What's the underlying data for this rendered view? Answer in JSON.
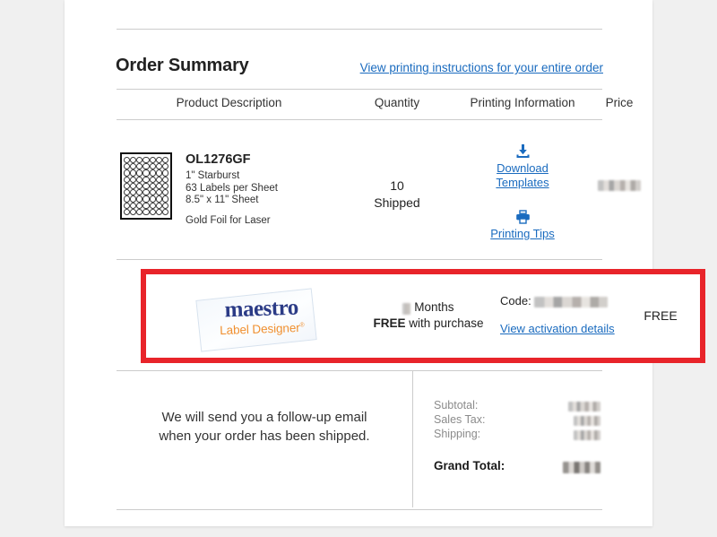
{
  "header": {
    "title": "Order Summary",
    "instructions_link": "View printing instructions for your entire order"
  },
  "columns": {
    "product": "Product Description",
    "quantity": "Quantity",
    "printing": "Printing Information",
    "price": "Price"
  },
  "product_row": {
    "sku": "OL1276GF",
    "size": "1\" Starburst",
    "labels_per_sheet": "63 Labels per Sheet",
    "sheet_size": "8.5\" x 11\" Sheet",
    "material": "Gold Foil for Laser",
    "quantity_count": "10",
    "quantity_status": "Shipped",
    "download_link": "Download Templates",
    "download_line1": "Download",
    "download_line2": "Templates",
    "printing_tips_link": "Printing Tips",
    "price": "",
    "price_redacted": true,
    "thumbnail": {
      "columns": 7,
      "rows": 9,
      "shape": "circle"
    }
  },
  "maestro_row": {
    "highlighted": true,
    "highlight_color": "#e8242a",
    "logo_main": "maestro",
    "logo_sub": "Label Designer",
    "logo_registered_mark": "®",
    "months_value": "",
    "months_value_redacted": true,
    "months_label": "Months",
    "free_bold": "FREE",
    "free_rest": " with purchase",
    "code_label": "Code:",
    "code_value": "",
    "code_value_redacted": true,
    "activation_link": "View activation details",
    "price": "FREE"
  },
  "footer": {
    "message_line1": "We will send you a follow-up email",
    "message_line2": "when your order has been shipped.",
    "totals": [
      {
        "label": "Subtotal:",
        "value": "",
        "redacted": true
      },
      {
        "label": "Sales Tax:",
        "value": "",
        "redacted": true
      },
      {
        "label": "Shipping:",
        "value": "",
        "redacted": true
      }
    ],
    "grand_total_label": "Grand Total:",
    "grand_total_value": "",
    "grand_total_redacted": true
  },
  "icons": {
    "download": "download-icon",
    "printer": "printer-icon"
  },
  "colors": {
    "link": "#1a6bbf",
    "highlight": "#e8242a",
    "logo_navy": "#2b3b86",
    "logo_orange": "#f09030",
    "page_bg": "#f0f0f0",
    "paper_bg": "#ffffff"
  }
}
